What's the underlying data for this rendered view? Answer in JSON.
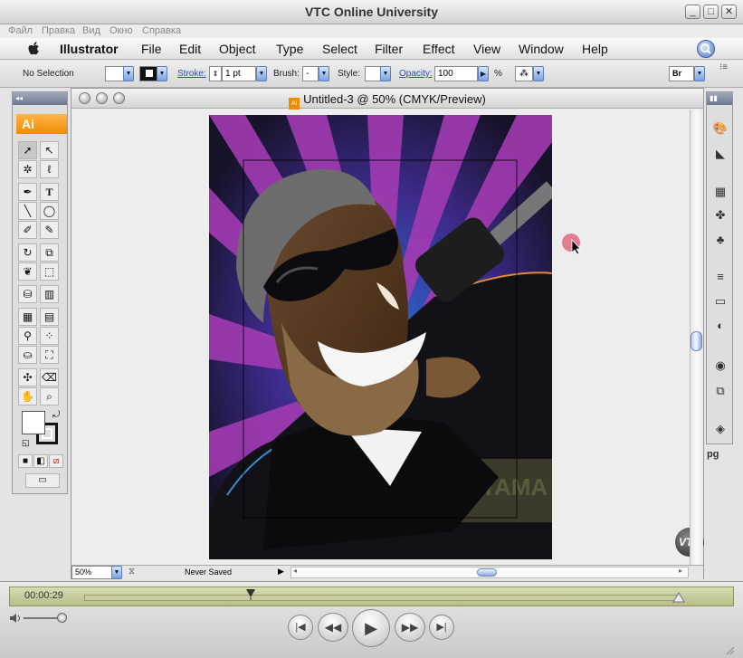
{
  "window": {
    "title": "VTC Online University"
  },
  "system_menu": [
    "Файл",
    "Правка",
    "Вид",
    "Окно",
    "Справка"
  ],
  "app_menu": {
    "app_name": "Illustrator",
    "items": [
      "File",
      "Edit",
      "Object",
      "Type",
      "Select",
      "Filter",
      "Effect",
      "View",
      "Window",
      "Help"
    ]
  },
  "control_bar": {
    "selection": "No Selection",
    "stroke_label": "Stroke:",
    "stroke_value": "1 pt",
    "brush_label": "Brush:",
    "brush_value": "-",
    "style_label": "Style:",
    "opacity_label": "Opacity:",
    "opacity_value": "100",
    "opacity_unit": "%",
    "bridge_label": "Br"
  },
  "toolbox": {
    "badge": "Ai"
  },
  "document": {
    "title": "Untitled-3 @ 50% (CMYK/Preview)",
    "zoom": "50%",
    "save_status": "Never Saved",
    "artwork_text": "YAMA"
  },
  "right_panel": {
    "partial_label": "pg"
  },
  "watermark": "VTC",
  "player": {
    "timecode": "00:00:29",
    "progress": 0.28
  }
}
